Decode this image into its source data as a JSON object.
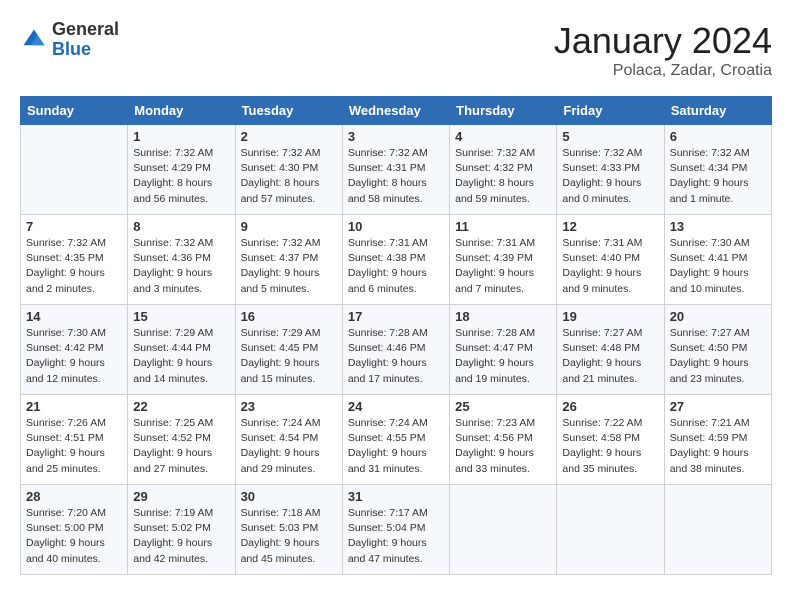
{
  "logo": {
    "general": "General",
    "blue": "Blue"
  },
  "header": {
    "month_year": "January 2024",
    "location": "Polaca, Zadar, Croatia"
  },
  "days_of_week": [
    "Sunday",
    "Monday",
    "Tuesday",
    "Wednesday",
    "Thursday",
    "Friday",
    "Saturday"
  ],
  "weeks": [
    [
      {
        "day": "",
        "info": ""
      },
      {
        "day": "1",
        "info": "Sunrise: 7:32 AM\nSunset: 4:29 PM\nDaylight: 8 hours\nand 56 minutes."
      },
      {
        "day": "2",
        "info": "Sunrise: 7:32 AM\nSunset: 4:30 PM\nDaylight: 8 hours\nand 57 minutes."
      },
      {
        "day": "3",
        "info": "Sunrise: 7:32 AM\nSunset: 4:31 PM\nDaylight: 8 hours\nand 58 minutes."
      },
      {
        "day": "4",
        "info": "Sunrise: 7:32 AM\nSunset: 4:32 PM\nDaylight: 8 hours\nand 59 minutes."
      },
      {
        "day": "5",
        "info": "Sunrise: 7:32 AM\nSunset: 4:33 PM\nDaylight: 9 hours\nand 0 minutes."
      },
      {
        "day": "6",
        "info": "Sunrise: 7:32 AM\nSunset: 4:34 PM\nDaylight: 9 hours\nand 1 minute."
      }
    ],
    [
      {
        "day": "7",
        "info": "Sunrise: 7:32 AM\nSunset: 4:35 PM\nDaylight: 9 hours\nand 2 minutes."
      },
      {
        "day": "8",
        "info": "Sunrise: 7:32 AM\nSunset: 4:36 PM\nDaylight: 9 hours\nand 3 minutes."
      },
      {
        "day": "9",
        "info": "Sunrise: 7:32 AM\nSunset: 4:37 PM\nDaylight: 9 hours\nand 5 minutes."
      },
      {
        "day": "10",
        "info": "Sunrise: 7:31 AM\nSunset: 4:38 PM\nDaylight: 9 hours\nand 6 minutes."
      },
      {
        "day": "11",
        "info": "Sunrise: 7:31 AM\nSunset: 4:39 PM\nDaylight: 9 hours\nand 7 minutes."
      },
      {
        "day": "12",
        "info": "Sunrise: 7:31 AM\nSunset: 4:40 PM\nDaylight: 9 hours\nand 9 minutes."
      },
      {
        "day": "13",
        "info": "Sunrise: 7:30 AM\nSunset: 4:41 PM\nDaylight: 9 hours\nand 10 minutes."
      }
    ],
    [
      {
        "day": "14",
        "info": "Sunrise: 7:30 AM\nSunset: 4:42 PM\nDaylight: 9 hours\nand 12 minutes."
      },
      {
        "day": "15",
        "info": "Sunrise: 7:29 AM\nSunset: 4:44 PM\nDaylight: 9 hours\nand 14 minutes."
      },
      {
        "day": "16",
        "info": "Sunrise: 7:29 AM\nSunset: 4:45 PM\nDaylight: 9 hours\nand 15 minutes."
      },
      {
        "day": "17",
        "info": "Sunrise: 7:28 AM\nSunset: 4:46 PM\nDaylight: 9 hours\nand 17 minutes."
      },
      {
        "day": "18",
        "info": "Sunrise: 7:28 AM\nSunset: 4:47 PM\nDaylight: 9 hours\nand 19 minutes."
      },
      {
        "day": "19",
        "info": "Sunrise: 7:27 AM\nSunset: 4:48 PM\nDaylight: 9 hours\nand 21 minutes."
      },
      {
        "day": "20",
        "info": "Sunrise: 7:27 AM\nSunset: 4:50 PM\nDaylight: 9 hours\nand 23 minutes."
      }
    ],
    [
      {
        "day": "21",
        "info": "Sunrise: 7:26 AM\nSunset: 4:51 PM\nDaylight: 9 hours\nand 25 minutes."
      },
      {
        "day": "22",
        "info": "Sunrise: 7:25 AM\nSunset: 4:52 PM\nDaylight: 9 hours\nand 27 minutes."
      },
      {
        "day": "23",
        "info": "Sunrise: 7:24 AM\nSunset: 4:54 PM\nDaylight: 9 hours\nand 29 minutes."
      },
      {
        "day": "24",
        "info": "Sunrise: 7:24 AM\nSunset: 4:55 PM\nDaylight: 9 hours\nand 31 minutes."
      },
      {
        "day": "25",
        "info": "Sunrise: 7:23 AM\nSunset: 4:56 PM\nDaylight: 9 hours\nand 33 minutes."
      },
      {
        "day": "26",
        "info": "Sunrise: 7:22 AM\nSunset: 4:58 PM\nDaylight: 9 hours\nand 35 minutes."
      },
      {
        "day": "27",
        "info": "Sunrise: 7:21 AM\nSunset: 4:59 PM\nDaylight: 9 hours\nand 38 minutes."
      }
    ],
    [
      {
        "day": "28",
        "info": "Sunrise: 7:20 AM\nSunset: 5:00 PM\nDaylight: 9 hours\nand 40 minutes."
      },
      {
        "day": "29",
        "info": "Sunrise: 7:19 AM\nSunset: 5:02 PM\nDaylight: 9 hours\nand 42 minutes."
      },
      {
        "day": "30",
        "info": "Sunrise: 7:18 AM\nSunset: 5:03 PM\nDaylight: 9 hours\nand 45 minutes."
      },
      {
        "day": "31",
        "info": "Sunrise: 7:17 AM\nSunset: 5:04 PM\nDaylight: 9 hours\nand 47 minutes."
      },
      {
        "day": "",
        "info": ""
      },
      {
        "day": "",
        "info": ""
      },
      {
        "day": "",
        "info": ""
      }
    ]
  ]
}
